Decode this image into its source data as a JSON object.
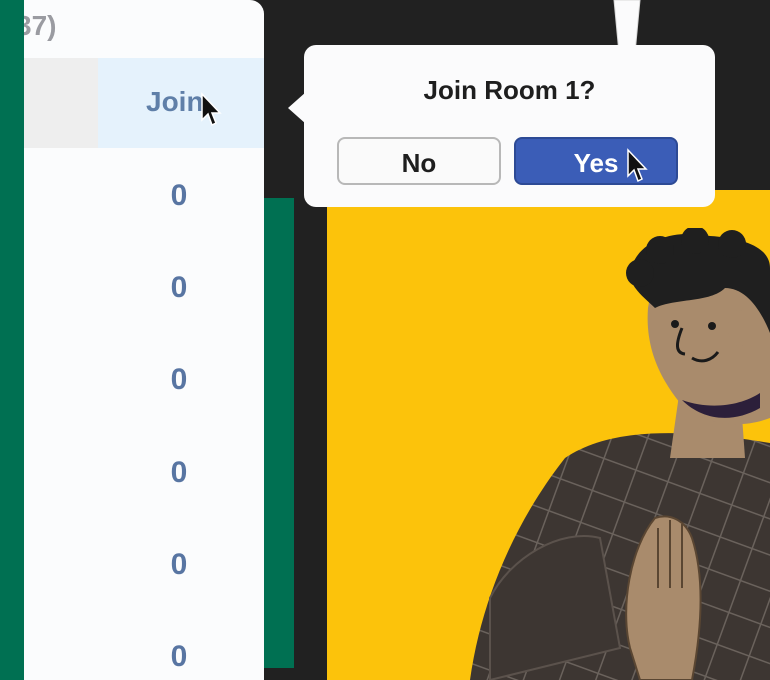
{
  "panel": {
    "header_text": "37)",
    "join_column_label": "Join",
    "join_counts": [
      "0",
      "0",
      "0",
      "0",
      "0",
      "0"
    ]
  },
  "dialog": {
    "title": "Join Room 1?",
    "no_label": "No",
    "yes_label": "Yes"
  },
  "colors": {
    "brand_green": "#007052",
    "accent_blue": "#3b5db7",
    "stage_yellow": "#fcc30b",
    "background": "#212121"
  }
}
